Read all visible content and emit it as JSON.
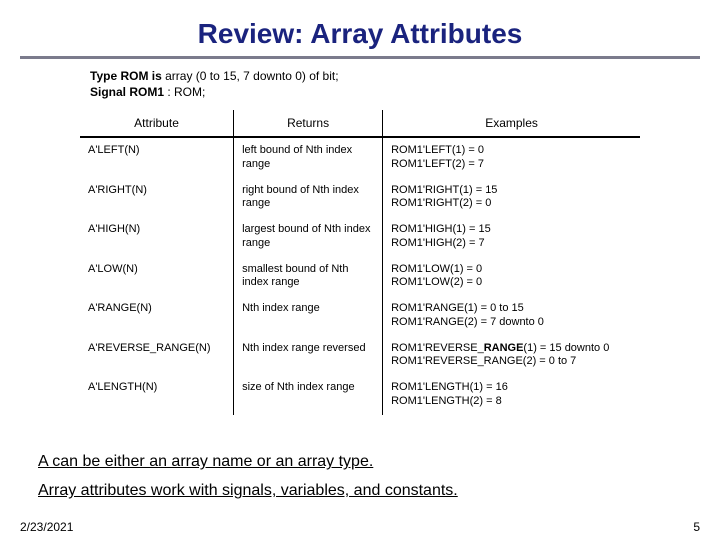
{
  "title": "Review: Array Attributes",
  "decl": {
    "l1_b": "Type ROM is",
    "l1_r": " array (0 to 15, 7 downto 0) of bit;",
    "l2_b": "Signal ROM1",
    "l2_r": " : ROM;"
  },
  "headers": {
    "c1": "Attribute",
    "c2": "Returns",
    "c3": "Examples"
  },
  "rows": [
    {
      "attr": "A'LEFT(N)",
      "ret": "left bound of Nth index range",
      "ex": "ROM1'LEFT(1) = 0\nROM1'LEFT(2) = 7"
    },
    {
      "attr": "A'RIGHT(N)",
      "ret": "right bound of Nth index range",
      "ex": "ROM1'RIGHT(1) = 15\nROM1'RIGHT(2) = 0"
    },
    {
      "attr": "A'HIGH(N)",
      "ret": "largest bound of Nth index range",
      "ex": "ROM1'HIGH(1) = 15\nROM1'HIGH(2) = 7"
    },
    {
      "attr": "A'LOW(N)",
      "ret": "smallest bound of Nth index range",
      "ex": "ROM1'LOW(1) = 0\nROM1'LOW(2) = 0"
    },
    {
      "attr": "A'RANGE(N)",
      "ret": "Nth index range",
      "ex": "ROM1'RANGE(1) = 0 to 15\nROM1'RANGE(2) = 7 downto 0"
    },
    {
      "attr": "A'REVERSE_RANGE(N)",
      "ret": "Nth index range reversed",
      "ex": "ROM1'REVERSE_RANGE(1) = 15 downto 0\nROM1'REVERSE_RANGE(2) = 0 to 7"
    },
    {
      "attr": "A'LENGTH(N)",
      "ret": "size of Nth index range",
      "ex": "ROM1'LENGTH(1) = 16\nROM1'LENGTH(2) = 8"
    }
  ],
  "notes": {
    "n1": "A can be either an array name or an array type.",
    "n2": "Array attributes work with signals, variables, and constants."
  },
  "footer": {
    "date": "2/23/2021",
    "page": "5"
  }
}
